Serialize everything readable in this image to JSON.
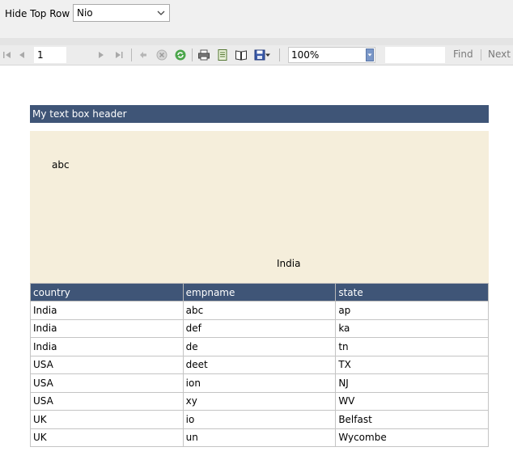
{
  "parameters": {
    "label": "Hide Top Row",
    "selected": "Nio"
  },
  "toolbar": {
    "page_number": "1",
    "zoom": "100%",
    "find_label": "Find",
    "next_label": "Next"
  },
  "report": {
    "header_title": "My text box header",
    "textbox": {
      "line1": "abc",
      "line2": "India"
    },
    "table": {
      "columns": [
        "country",
        "empname",
        "state"
      ],
      "rows": [
        [
          "India",
          "abc",
          "ap"
        ],
        [
          "India",
          "def",
          "ka"
        ],
        [
          "India",
          "de",
          "tn"
        ],
        [
          "USA",
          "deet",
          "TX"
        ],
        [
          "USA",
          "ion",
          "NJ"
        ],
        [
          "USA",
          "xy",
          "WV"
        ],
        [
          "UK",
          "io",
          "Belfast"
        ],
        [
          "UK",
          "un",
          "Wycombe"
        ]
      ]
    }
  },
  "colors": {
    "header_bg": "#3f5577",
    "textbox_bg": "#f5eedb"
  }
}
